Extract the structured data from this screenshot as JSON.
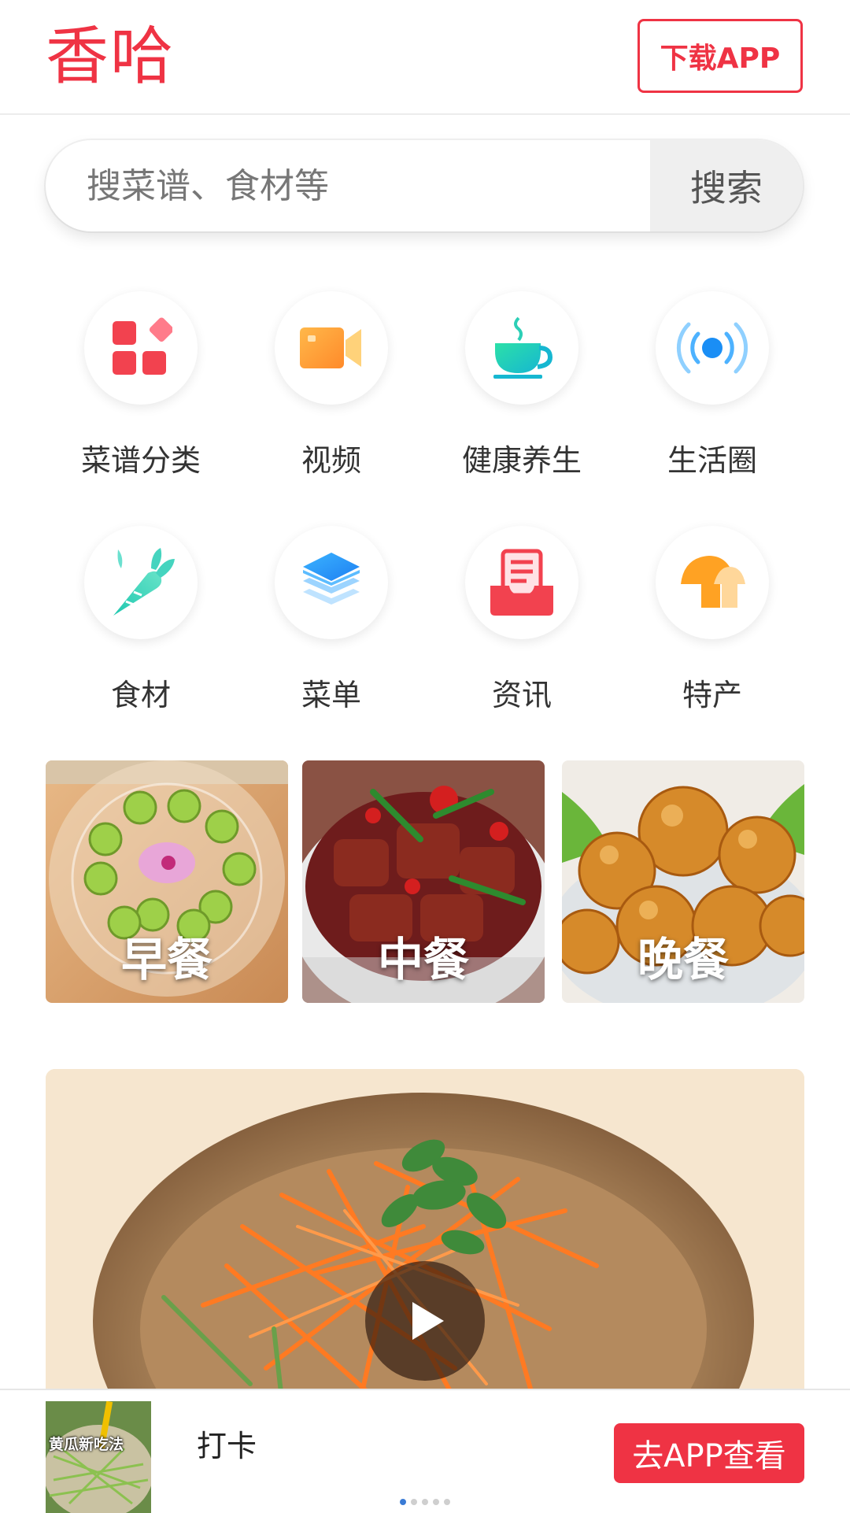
{
  "header": {
    "logo": "香哈",
    "download_label": "下载APP"
  },
  "search": {
    "placeholder": "搜菜谱、食材等",
    "button_label": "搜索"
  },
  "categories": [
    {
      "label": "菜谱分类",
      "icon": "grid-apps-icon"
    },
    {
      "label": "视频",
      "icon": "video-camera-icon"
    },
    {
      "label": "健康养生",
      "icon": "teacup-icon"
    },
    {
      "label": "生活圈",
      "icon": "broadcast-icon"
    },
    {
      "label": "食材",
      "icon": "carrot-icon"
    },
    {
      "label": "菜单",
      "icon": "layers-icon"
    },
    {
      "label": "资讯",
      "icon": "news-inbox-icon"
    },
    {
      "label": "特产",
      "icon": "mushroom-icon"
    }
  ],
  "meals": [
    {
      "label": "早餐"
    },
    {
      "label": "中餐"
    },
    {
      "label": "晚餐"
    }
  ],
  "bottom_bar": {
    "thumb_text": "黄瓜新吃法",
    "text": "打卡",
    "button_label": "去APP查看"
  },
  "colors": {
    "brand": "#ef3344",
    "text": "#333333"
  }
}
